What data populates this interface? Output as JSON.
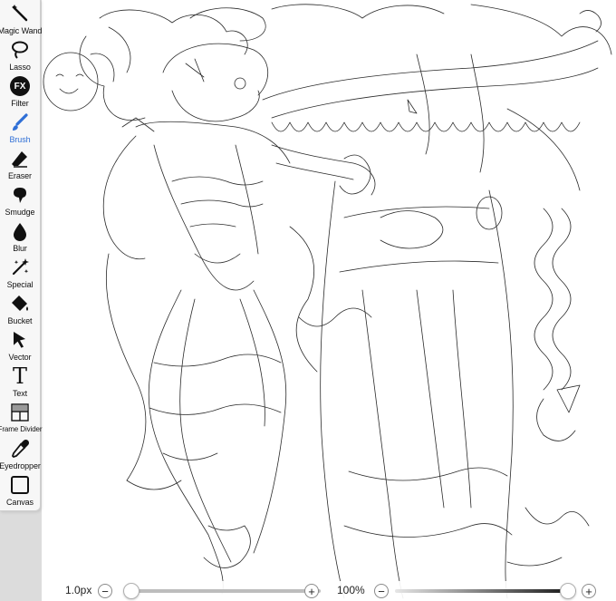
{
  "toolbar": {
    "tools": [
      {
        "id": "magic-wand",
        "label": "Magic Wand",
        "icon": "magic-wand-icon"
      },
      {
        "id": "lasso",
        "label": "Lasso",
        "icon": "lasso-icon"
      },
      {
        "id": "filter",
        "label": "Filter",
        "icon": "fx-icon",
        "icon_text": "FX"
      },
      {
        "id": "brush",
        "label": "Brush",
        "icon": "brush-icon",
        "active": true
      },
      {
        "id": "eraser",
        "label": "Eraser",
        "icon": "eraser-icon"
      },
      {
        "id": "smudge",
        "label": "Smudge",
        "icon": "smudge-icon"
      },
      {
        "id": "blur",
        "label": "Blur",
        "icon": "blur-drop-icon"
      },
      {
        "id": "special",
        "label": "Special",
        "icon": "sparkle-icon"
      },
      {
        "id": "bucket",
        "label": "Bucket",
        "icon": "bucket-icon"
      },
      {
        "id": "vector",
        "label": "Vector",
        "icon": "cursor-arrow-icon"
      },
      {
        "id": "text",
        "label": "Text",
        "icon": "text-icon",
        "icon_text": "T"
      },
      {
        "id": "frame-divider",
        "label": "Frame Divider",
        "icon": "frame-divider-icon"
      },
      {
        "id": "eyedropper",
        "label": "Eyedropper",
        "icon": "eyedropper-icon"
      },
      {
        "id": "canvas",
        "label": "Canvas",
        "icon": "canvas-icon"
      }
    ],
    "accent_color": "#2f6fd6"
  },
  "bottom_bar": {
    "brush_size": "1.0px",
    "brush_size_minus": "−",
    "brush_size_plus": "+",
    "opacity": "100%",
    "opacity_minus": "−",
    "opacity_plus": "+",
    "brush_size_level": 0.0,
    "opacity_level": 1.0
  },
  "canvas": {
    "content": "pencil sketch artwork"
  }
}
